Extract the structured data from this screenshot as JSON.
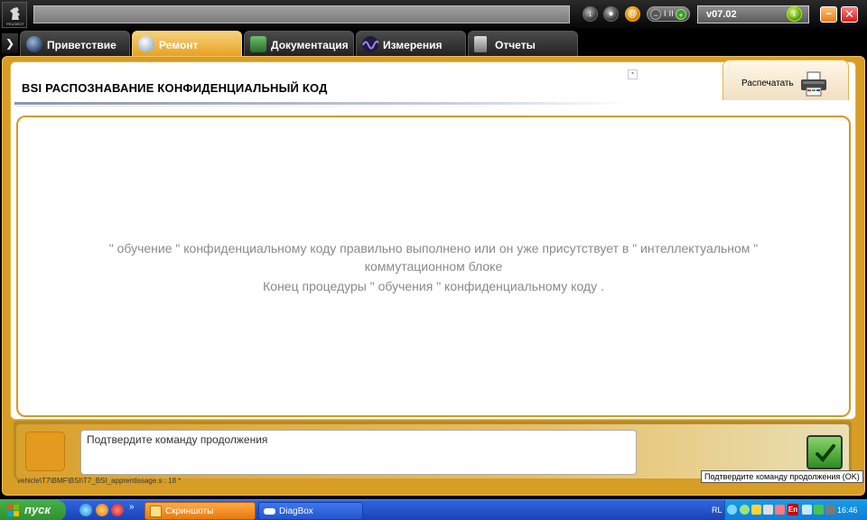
{
  "topbar": {
    "logo_text": "PEUGEOT",
    "title_field": "",
    "version": "v07.02",
    "toggle_bars": "I II"
  },
  "tabs": [
    {
      "label": "Приветствие",
      "icon": "globe-icon"
    },
    {
      "label": "Ремонт",
      "icon": "magnifier-icon",
      "active": true
    },
    {
      "label": "Документация",
      "icon": "book-icon"
    },
    {
      "label": "Измерения",
      "icon": "wave-icon"
    },
    {
      "label": "Отчеты",
      "icon": "report-icon"
    }
  ],
  "main": {
    "title": "BSI  РАСПОЗНАВАНИЕ КОНФИДЕНЦИАЛЬНЫЙ КОД",
    "print_label": "Распечатать",
    "message_line1": "\" обучение \" конфиденциальному коду правильно выполнено или он уже присутствует в \" интеллектуальном \"",
    "message_line2": "коммутационном блоке",
    "message_line3": "Конец процедуры \" обучения \" конфиденциальному коду ."
  },
  "bottom": {
    "confirm_text": "Подтвердите команду продолжения",
    "path_text": "vehicle\\T7\\BMF\\BSI\\T7_BSI_apprentissage.s : 18 *",
    "tooltip": "Подтвердите команду продолжения (OK)"
  },
  "taskbar": {
    "start_label": "пуск",
    "tasks": [
      {
        "label": "Скриншоты"
      },
      {
        "label": "DiagBox"
      }
    ],
    "lang": "RL",
    "tray_lang": "En",
    "clock": "16:46"
  },
  "colors": {
    "accent_orange": "#d79d25",
    "active_tab": "#e89f21",
    "message_gray": "#8a8a8a",
    "ok_green": "#2e8c1f"
  }
}
